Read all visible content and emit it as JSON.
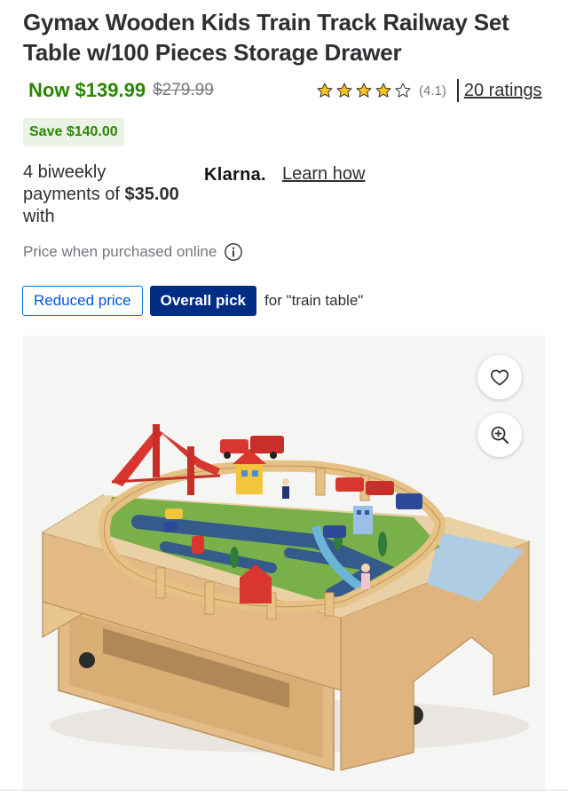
{
  "product": {
    "title_line1": "Gymax Wooden Kids Train Track Railway Set",
    "title_line2": "Table w/100 Pieces Storage Drawer"
  },
  "price": {
    "now": "Now $139.99",
    "was": "$279.99",
    "save_badge": "Save $140.00"
  },
  "rating": {
    "stars": 4.1,
    "value_text": "(4.1)",
    "count_link": "20 ratings",
    "star_color": "#ffc220"
  },
  "klarna": {
    "line1": "4 biweekly",
    "line2_prefix": "payments of ",
    "amount": "$35.00",
    "line3": "with",
    "logo": "Klarna.",
    "learn_how": "Learn how"
  },
  "online": {
    "text": "Price when purchased online",
    "icon": "info-icon"
  },
  "tags": {
    "reduced": "Reduced price",
    "overall": "Overall pick",
    "context": "for \"train table\""
  },
  "image_actions": {
    "favorite_icon": "heart-icon",
    "zoom_icon": "zoom-in-icon"
  },
  "colors": {
    "price_green": "#2a8703",
    "save_bg": "#eaf3e6",
    "walmart_blue": "#0071dc",
    "pick_navy": "#002d84"
  }
}
